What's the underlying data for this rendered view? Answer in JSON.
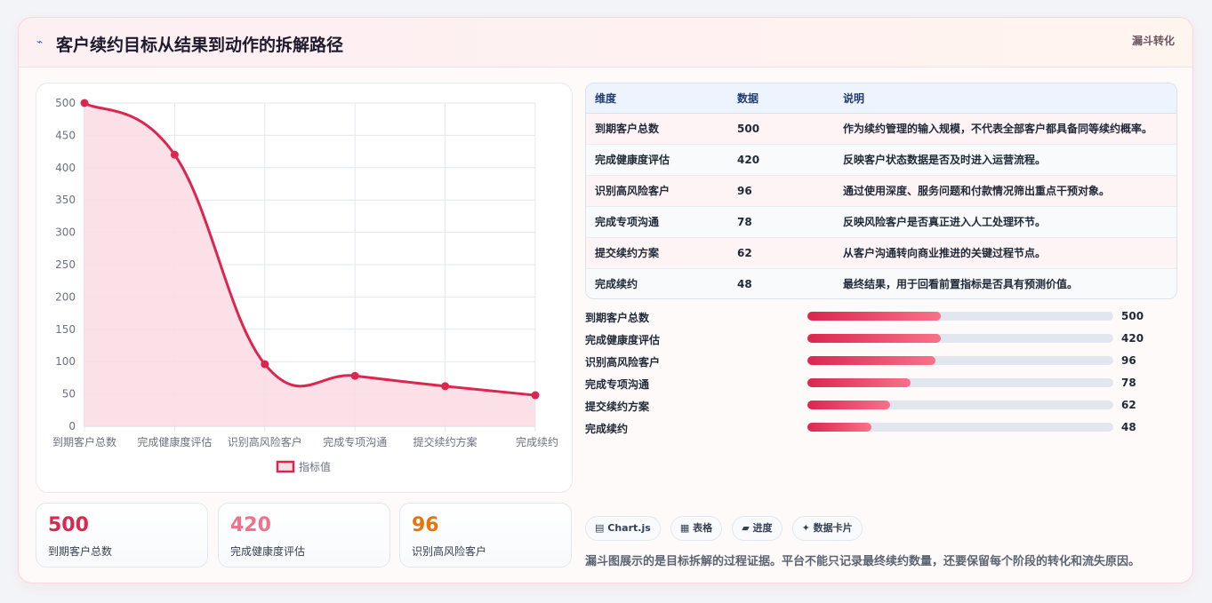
{
  "header": {
    "title": "客户续约目标从结果到动作的拆解路径",
    "tag": "漏斗转化",
    "icon": "spark-icon"
  },
  "colors": {
    "accent": "#dc2650",
    "accent_light": "#f87189",
    "orange": "#e8740c",
    "fill": "#fbdde4"
  },
  "chart_data": {
    "type": "area",
    "categories": [
      "到期客户总数",
      "完成健康度评估",
      "识别高风险客户",
      "完成专项沟通",
      "提交续约方案",
      "完成续约"
    ],
    "series": [
      {
        "name": "指标值",
        "values": [
          500,
          420,
          96,
          78,
          62,
          48
        ]
      }
    ],
    "ylim": [
      0,
      500
    ],
    "yticks": [
      "0",
      "50",
      "100",
      "150",
      "200",
      "250",
      "300",
      "350",
      "400",
      "450",
      "500"
    ],
    "grid": true,
    "legend": "bottom"
  },
  "stats": [
    {
      "value": "500",
      "label": "到期客户总数"
    },
    {
      "value": "420",
      "label": "完成健康度评估"
    },
    {
      "value": "96",
      "label": "识别高风险客户"
    }
  ],
  "table": {
    "headers": [
      "维度",
      "数据",
      "说明"
    ],
    "rows": [
      [
        "到期客户总数",
        "500",
        "作为续约管理的输入规模，不代表全部客户都具备同等续约概率。"
      ],
      [
        "完成健康度评估",
        "420",
        "反映客户状态数据是否及时进入运营流程。"
      ],
      [
        "识别高风险客户",
        "96",
        "通过使用深度、服务问题和付款情况筛出重点干预对象。"
      ],
      [
        "完成专项沟通",
        "78",
        "反映风险客户是否真正进入人工处理环节。"
      ],
      [
        "提交续约方案",
        "62",
        "从客户沟通转向商业推进的关键过程节点。"
      ],
      [
        "完成续约",
        "48",
        "最终结果，用于回看前置指标是否具有预测价值。"
      ]
    ]
  },
  "progress": [
    {
      "label": "到期客户总数",
      "value": "500",
      "fraction": 0.435
    },
    {
      "label": "完成健康度评估",
      "value": "420",
      "fraction": 0.435
    },
    {
      "label": "识别高风险客户",
      "value": "96",
      "fraction": 0.418
    },
    {
      "label": "完成专项沟通",
      "value": "78",
      "fraction": 0.338
    },
    {
      "label": "提交续约方案",
      "value": "62",
      "fraction": 0.27
    },
    {
      "label": "完成续约",
      "value": "48",
      "fraction": 0.209
    }
  ],
  "chips": [
    {
      "icon": "▤",
      "label": "Chart.js"
    },
    {
      "icon": "▦",
      "label": "表格"
    },
    {
      "icon": "▰",
      "label": "进度"
    },
    {
      "icon": "✦",
      "label": "数据卡片"
    }
  ],
  "note": "漏斗图展示的是目标拆解的过程证据。平台不能只记录最终续约数量，还要保留每个阶段的转化和流失原因。"
}
